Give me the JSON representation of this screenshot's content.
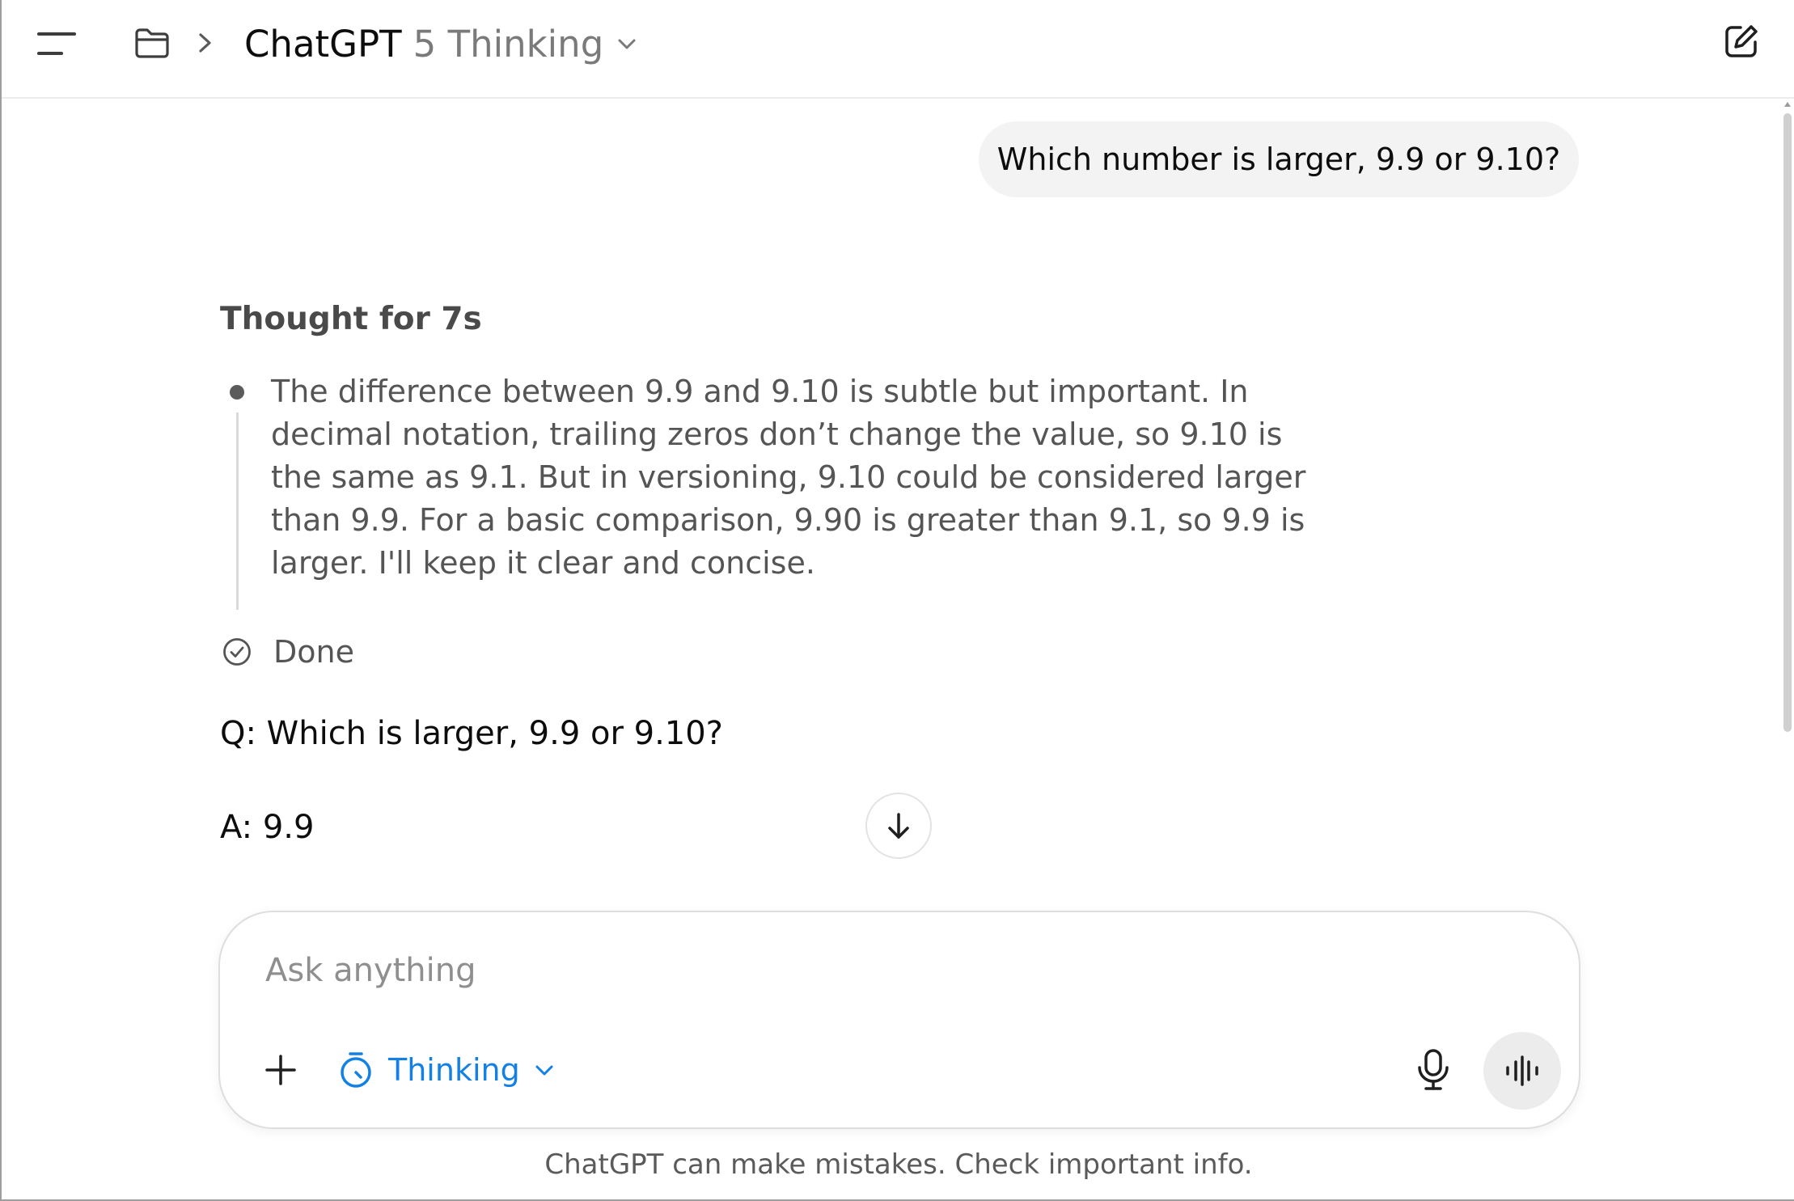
{
  "header": {
    "model_name": "ChatGPT",
    "model_variant": "5 Thinking"
  },
  "conversation": {
    "user_message": "Which number is larger, 9.9 or 9.10?",
    "thought_header": "Thought for 7s",
    "thought_text": "The difference between 9.9 and 9.10 is subtle but important. In decimal notation, trailing zeros don’t change the value, so 9.10 is the same as 9.1. But in versioning, 9.10 could be considered larger than 9.9. For a basic comparison, 9.90 is greater than 9.1, so 9.9 is larger. I'll keep it clear and concise.",
    "done_label": "Done",
    "answer_q": "Q: Which is larger, 9.9 or 9.10?",
    "answer_a": "A: 9.9"
  },
  "composer": {
    "placeholder": "Ask anything",
    "value": "",
    "mode_label": "Thinking"
  },
  "footer": {
    "disclaimer": "ChatGPT can make mistakes. Check important info."
  },
  "colors": {
    "accent": "#1380e5",
    "bubble_bg": "#f3f3f3",
    "muted_text": "#555555"
  },
  "icons": [
    "menu-icon",
    "folder-icon",
    "chevron-right-icon",
    "chevron-down-icon",
    "edit-icon",
    "check-circle-icon",
    "arrow-down-icon",
    "plus-icon",
    "timer-icon",
    "microphone-icon",
    "voice-waveform-icon"
  ]
}
